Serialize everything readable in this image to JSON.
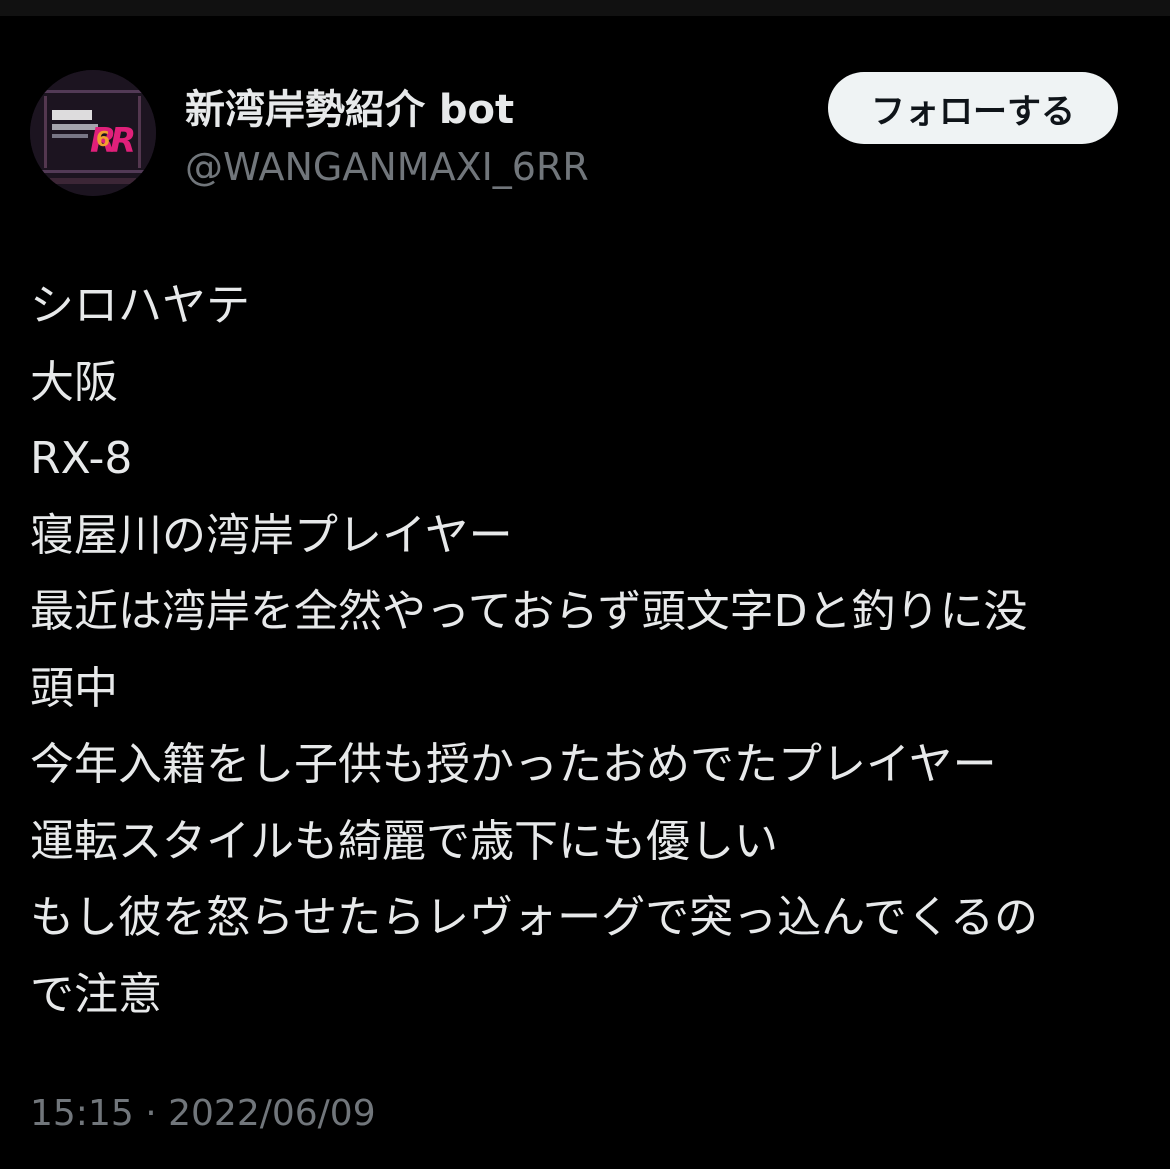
{
  "tweet": {
    "author": {
      "display_name": "新湾岸勢紹介 bot",
      "handle": "@WANGANMAXI_6RR",
      "avatar_icon": "wangan-midnight-6rr-logo"
    },
    "follow_label": "フォローする",
    "lines": [
      "シロハヤテ",
      "大阪",
      "RX-8",
      "寝屋川の湾岸プレイヤー",
      "最近は湾岸を全然やっておらず頭文字Dと釣りに没",
      "頭中",
      "今年入籍をし子供も授かったおめでたプレイヤー",
      "運転スタイルも綺麗で歳下にも優しい",
      "もし彼を怒らせたらレヴォーグで突っ込んでくるの",
      "で注意"
    ],
    "time": "15:15",
    "separator": "·",
    "date": "2022/06/09"
  },
  "colors": {
    "background": "#000000",
    "text": "#e7e9ea",
    "secondary_text": "#71767b",
    "button_bg": "#eff3f4",
    "button_text": "#0f1419"
  }
}
